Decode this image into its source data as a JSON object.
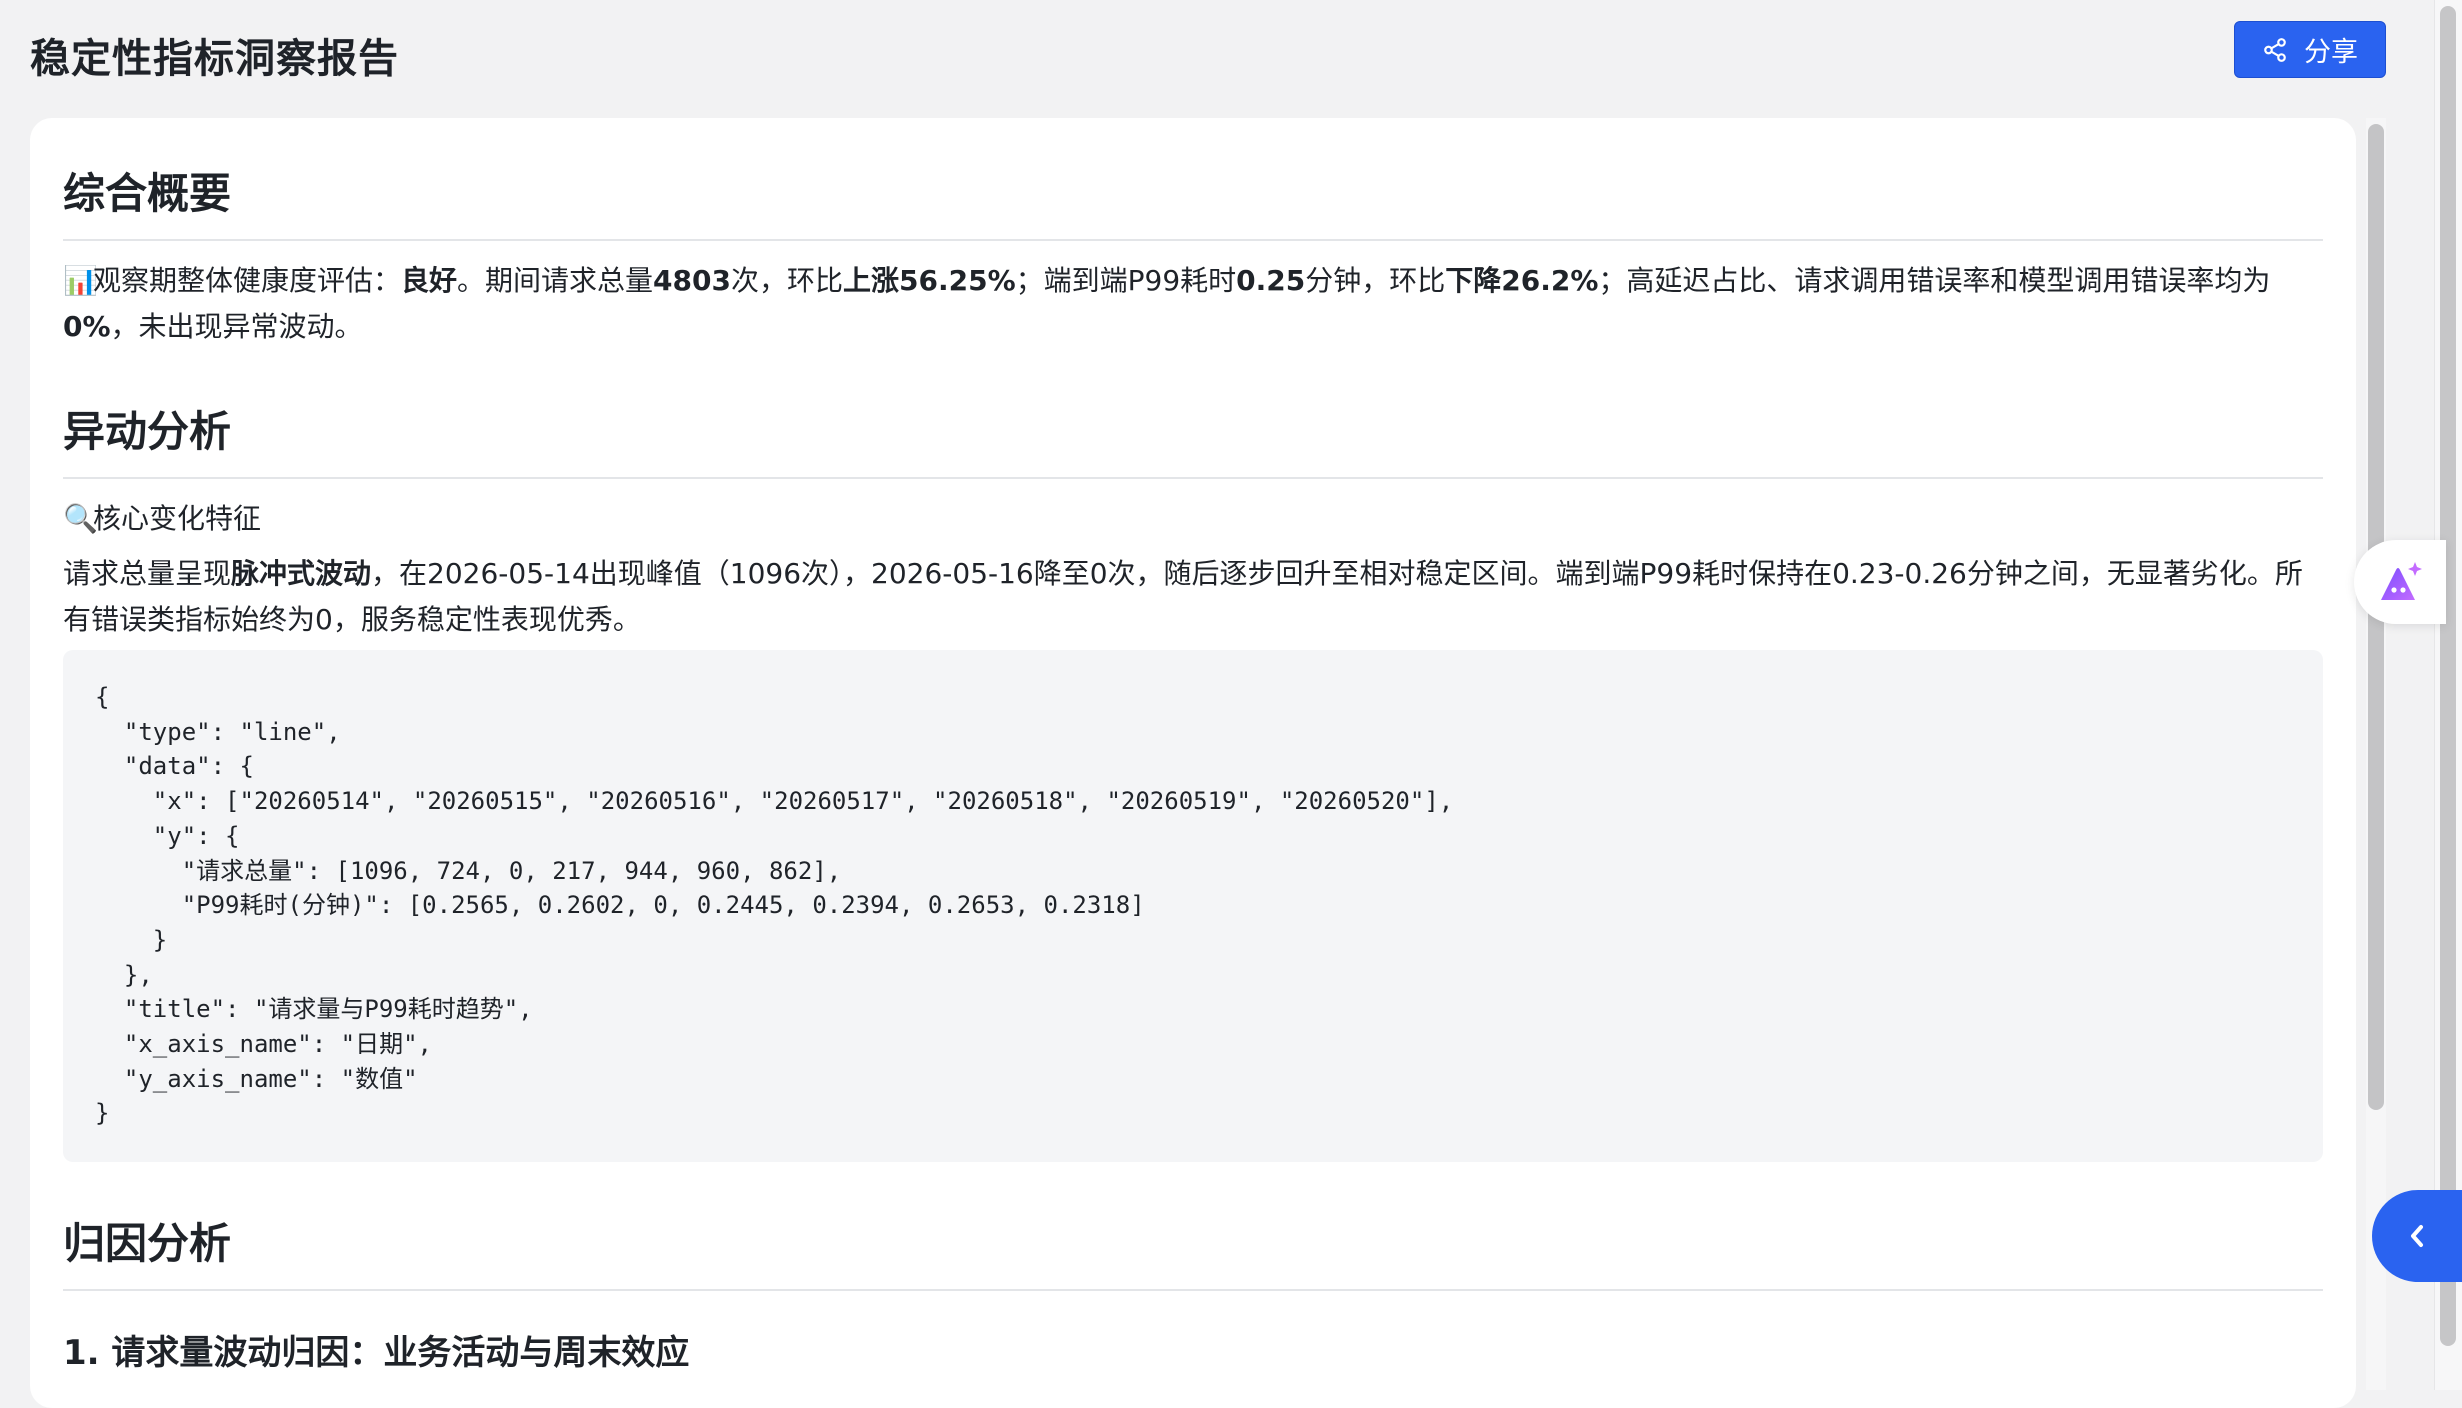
{
  "header": {
    "title": "稳定性指标洞察报告",
    "share_label": "分享"
  },
  "sections": {
    "overview": {
      "title": "综合概要",
      "emoji": "📊",
      "p1_pre": "观察期整体健康度评估：",
      "p1_b1": "良好",
      "p1_t2": "。期间请求总量",
      "p1_b2": "4803",
      "p1_t3": "次，环比",
      "p1_b3": "上涨56.25%",
      "p1_t4": "；端到端P99耗时",
      "p1_b4": "0.25",
      "p1_t5": "分钟，环比",
      "p1_b5": "下降26.2%",
      "p1_t6": "；高延迟占比、请求调用错误率和模型调用错误率均为",
      "p1_b6": "0%",
      "p1_t7": "，未出现异常波动。"
    },
    "anomaly": {
      "title": "异动分析",
      "emoji": "🔍",
      "subtitle": "核心变化特征",
      "p_pre": "请求总量呈现",
      "p_b1": "脉冲式波动",
      "p_rest": "，在2026-05-14出现峰值（1096次），2026-05-16降至0次，随后逐步回升至相对稳定区间。端到端P99耗时保持在0.23-0.26分钟之间，无显著劣化。所有错误类指标始终为0，服务稳定性表现优秀。",
      "code": "{\n  \"type\": \"line\",\n  \"data\": {\n    \"x\": [\"20260514\", \"20260515\", \"20260516\", \"20260517\", \"20260518\", \"20260519\", \"20260520\"],\n    \"y\": {\n      \"请求总量\": [1096, 724, 0, 217, 944, 960, 862],\n      \"P99耗时(分钟)\": [0.2565, 0.2602, 0, 0.2445, 0.2394, 0.2653, 0.2318]\n    }\n  },\n  \"title\": \"请求量与P99耗时趋势\",\n  \"x_axis_name\": \"日期\",\n  \"y_axis_name\": \"数值\"\n}"
    },
    "attribution": {
      "title": "归因分析",
      "sub1": "1. 请求量波动归因：业务活动与周末效应"
    }
  },
  "icons": {
    "share": "share-icon",
    "ai": "ai-assistant-icon",
    "collapse": "chevron-left-icon"
  },
  "colors": {
    "accent": "#2a63f0",
    "ai_gradient_start": "#7b4dff",
    "ai_gradient_end": "#c36bff"
  }
}
